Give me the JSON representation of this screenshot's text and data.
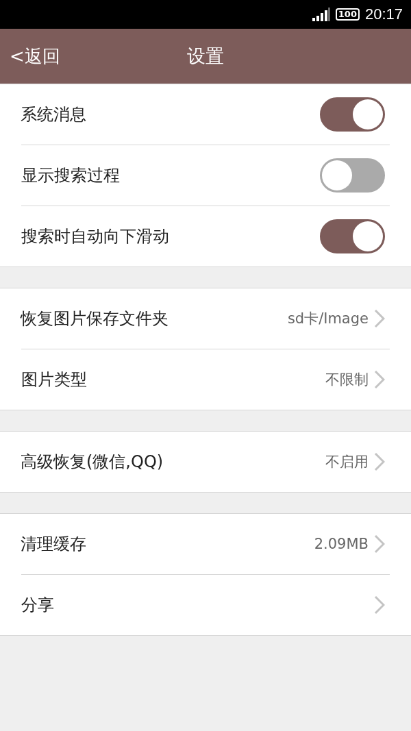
{
  "status_bar": {
    "battery": "100",
    "time": "20:17"
  },
  "header": {
    "back": "<返回",
    "title": "设置"
  },
  "groups": [
    {
      "rows": [
        {
          "kind": "toggle",
          "label": "系统消息",
          "on": true
        },
        {
          "kind": "toggle",
          "label": "显示搜索过程",
          "on": false
        },
        {
          "kind": "toggle",
          "label": "搜索时自动向下滑动",
          "on": true
        }
      ]
    },
    {
      "rows": [
        {
          "kind": "link",
          "label": "恢复图片保存文件夹",
          "value": "sd卡/Image"
        },
        {
          "kind": "link",
          "label": "图片类型",
          "value": "不限制"
        }
      ]
    },
    {
      "rows": [
        {
          "kind": "link",
          "label": "高级恢复(微信,QQ)",
          "value": "不启用"
        }
      ]
    },
    {
      "rows": [
        {
          "kind": "link",
          "label": "清理缓存",
          "value": "2.09MB"
        },
        {
          "kind": "link",
          "label": "分享"
        }
      ]
    }
  ]
}
